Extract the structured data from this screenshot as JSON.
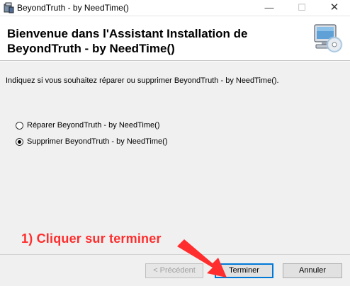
{
  "window": {
    "title": "BeyondTruth - by NeedTime()",
    "controls": {
      "minimize": "—",
      "maximize": "☐",
      "close": "✕"
    }
  },
  "banner": {
    "title": "Bienvenue dans l'Assistant Installation de BeyondTruth - by NeedTime()",
    "icon": "computer-cd-icon"
  },
  "instruction": "Indiquez si vous souhaitez réparer ou supprimer BeyondTruth - by NeedTime().",
  "options": [
    {
      "label": "Réparer BeyondTruth - by NeedTime()",
      "checked": false
    },
    {
      "label": "Supprimer BeyondTruth - by NeedTime()",
      "checked": true
    }
  ],
  "buttons": {
    "previous": "< Précédent",
    "finish": "Terminer",
    "cancel": "Annuler"
  },
  "annotation": {
    "text": "1) Cliquer sur terminer",
    "color": "#ff2d2d",
    "icon": "red-arrow-icon"
  }
}
